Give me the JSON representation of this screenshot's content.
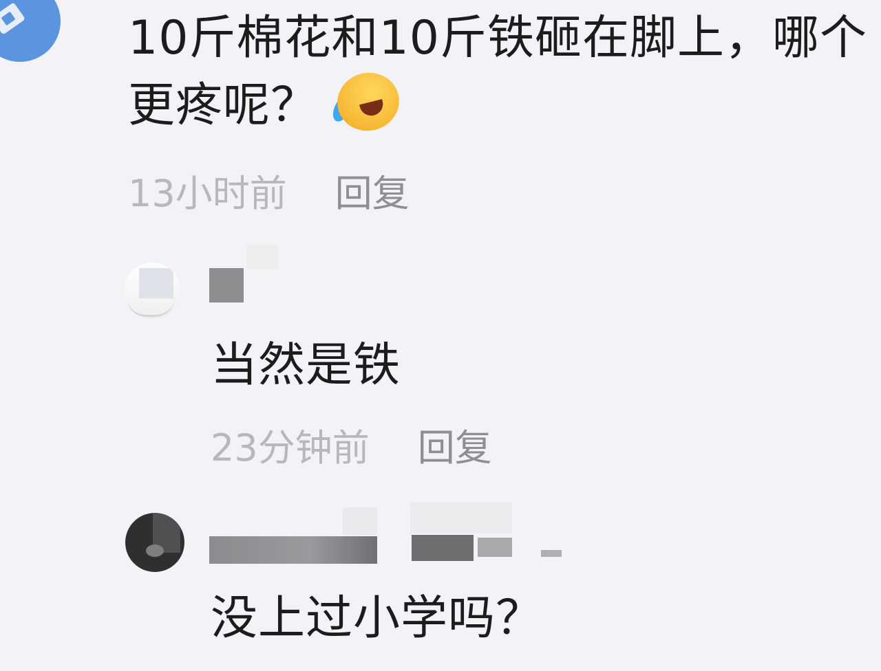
{
  "top_comment": {
    "text": "10斤棉花和10斤铁砸在脚上，哪个更疼呢？",
    "emoji": "laughing-crying-emoji",
    "time": "13小时前",
    "reply_label": "回复"
  },
  "replies": [
    {
      "text": "当然是铁",
      "time": "23分钟前",
      "reply_label": "回复"
    },
    {
      "text": "没上过小学吗？"
    }
  ],
  "colors": {
    "background": "#f3f2f7",
    "text": "#1c1c1c",
    "meta_time": "#b8b8bb",
    "meta_reply": "#8f8f92",
    "avatar_top": "#5b95df"
  }
}
